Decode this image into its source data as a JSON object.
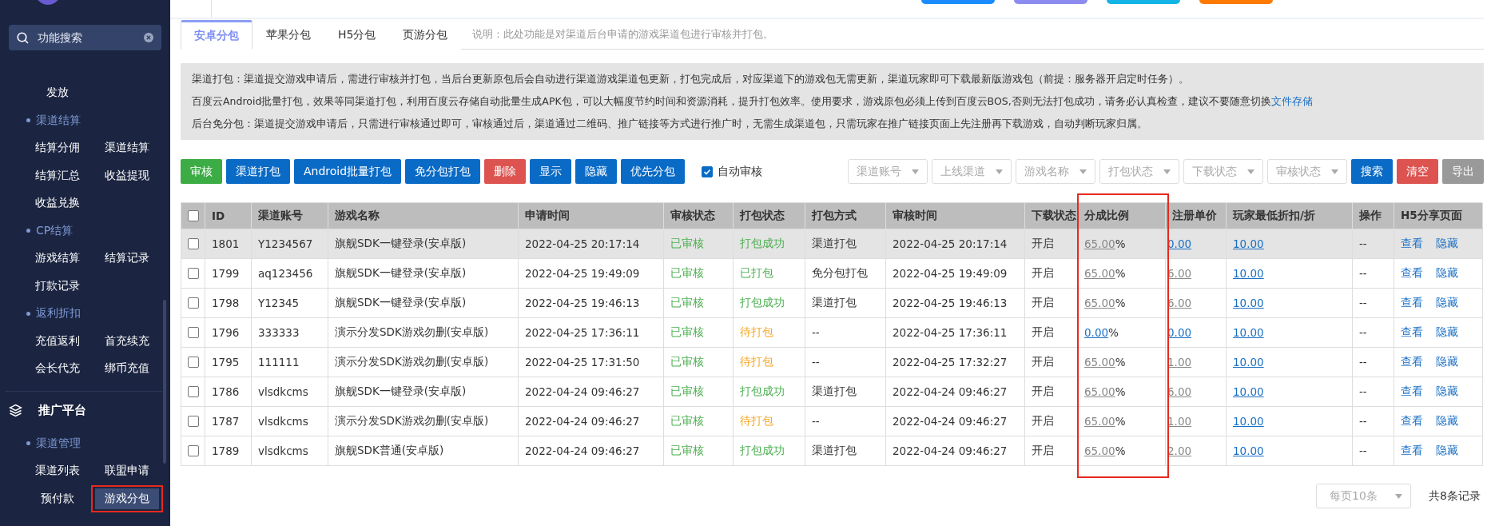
{
  "top_buttons": [
    {
      "color": "#1a8cff"
    },
    {
      "color": "#8c8cf0"
    },
    {
      "color": "#14b4e6"
    },
    {
      "color": "#ff7a00"
    }
  ],
  "sidebar": {
    "search": {
      "placeholder": "功能搜索"
    },
    "groups": [
      {
        "items": [
          {
            "label": "发放",
            "selected": false,
            "annotated": false
          }
        ]
      },
      {
        "title": "渠道结算",
        "items": [
          {
            "label": "结算分佣",
            "selected": false,
            "annotated": false
          },
          {
            "label": "渠道结算",
            "selected": false,
            "annotated": false
          },
          {
            "label": "结算汇总",
            "selected": false,
            "annotated": false
          },
          {
            "label": "收益提现",
            "selected": false,
            "annotated": false
          },
          {
            "label": "收益兑换",
            "selected": false,
            "annotated": false
          }
        ]
      },
      {
        "title": "CP结算",
        "items": [
          {
            "label": "游戏结算",
            "selected": false,
            "annotated": false
          },
          {
            "label": "结算记录",
            "selected": false,
            "annotated": false
          },
          {
            "label": "打款记录",
            "selected": false,
            "annotated": false
          }
        ]
      },
      {
        "title": "返利折扣",
        "items": [
          {
            "label": "充值返利",
            "selected": false,
            "annotated": false
          },
          {
            "label": "首充续充",
            "selected": false,
            "annotated": false
          },
          {
            "label": "会长代充",
            "selected": false,
            "annotated": false
          },
          {
            "label": "绑币充值",
            "selected": false,
            "annotated": false
          }
        ]
      }
    ],
    "menu": {
      "title": "推广平台",
      "groups": [
        {
          "title": "渠道管理",
          "items": [
            {
              "label": "渠道列表",
              "selected": false,
              "annotated": false
            },
            {
              "label": "联盟申请",
              "selected": false,
              "annotated": false
            },
            {
              "label": "预付款",
              "selected": false,
              "annotated": false
            },
            {
              "label": "游戏分包",
              "selected": true,
              "annotated": true
            }
          ]
        }
      ]
    }
  },
  "tabs": [
    {
      "label": "安卓分包",
      "selected": true
    },
    {
      "label": "苹果分包",
      "selected": false
    },
    {
      "label": "H5分包",
      "selected": false
    },
    {
      "label": "页游分包",
      "selected": false
    }
  ],
  "tab_note": "说明：此处功能是对渠道后台申请的游戏渠道包进行审核并打包。",
  "info": [
    {
      "text": "渠道打包：渠道提交游戏申请后，需进行审核并打包，当后台更新原包后会自动进行渠道游戏渠道包更新，打包完成后，对应渠道下的游戏包无需更新，渠道玩家即可下载最新版游戏包（前提：服务器开启定时任务）。"
    },
    {
      "text": "百度云Android批量打包，效果等同渠道打包，利用百度云存储自动批量生成APK包，可以大幅度节约时间和资源消耗，提升打包效率。使用要求，游戏原包必须上传到百度云BOS,否则无法打包成功，请务必认真检查，建议不要随意切换",
      "link": "文件存储"
    },
    {
      "text": "后台免分包：渠道提交游戏申请后，只需进行审核通过即可，审核通过后，渠道通过二维码、推广链接等方式进行推广时，无需生成渠道包，只需玩家在推广链接页面上先注册再下载游戏，自动判断玩家归属。"
    }
  ],
  "actions": [
    {
      "label": "审核",
      "kind": "success"
    },
    {
      "label": "渠道打包",
      "kind": "primary"
    },
    {
      "label": "Android批量打包",
      "kind": "primary"
    },
    {
      "label": "免分包打包",
      "kind": "primary"
    },
    {
      "label": "删除",
      "kind": "danger"
    },
    {
      "label": "显示",
      "kind": "primary"
    },
    {
      "label": "隐藏",
      "kind": "primary"
    },
    {
      "label": "优先分包",
      "kind": "primary"
    }
  ],
  "auto_review": {
    "label": "自动审核",
    "checked": true
  },
  "filters": [
    {
      "placeholder": "渠道账号"
    },
    {
      "placeholder": "上线渠道"
    },
    {
      "placeholder": "游戏名称"
    },
    {
      "placeholder": "打包状态"
    },
    {
      "placeholder": "下载状态"
    },
    {
      "placeholder": "审核状态"
    }
  ],
  "filter_buttons": [
    {
      "label": "搜索",
      "kind": "primary"
    },
    {
      "label": "清空",
      "kind": "danger"
    },
    {
      "label": "导出",
      "kind": "muted"
    }
  ],
  "table": {
    "all_checked": false,
    "columns": [
      {
        "label": "ID",
        "annotated": false
      },
      {
        "label": "渠道账号",
        "annotated": false
      },
      {
        "label": "游戏名称",
        "annotated": false
      },
      {
        "label": "申请时间",
        "annotated": false
      },
      {
        "label": "审核状态",
        "annotated": false
      },
      {
        "label": "打包状态",
        "annotated": false
      },
      {
        "label": "打包方式",
        "annotated": false
      },
      {
        "label": "审核时间",
        "annotated": false
      },
      {
        "label": "下载状态",
        "annotated": false
      },
      {
        "label": "分成比例",
        "annotated": true
      },
      {
        "label": "注册单价",
        "annotated": false
      },
      {
        "label": "玩家最低折扣/折",
        "annotated": false
      },
      {
        "label": "操作",
        "annotated": false
      },
      {
        "label": "H5分享页面",
        "annotated": false
      }
    ],
    "rows": [
      {
        "checked": false,
        "highlighted": true,
        "id": "1801",
        "account": "Y1234567",
        "game": "旗舰SDK一键登录(安卓版)",
        "apply_time": "2022-04-25 20:17:14",
        "review_status": "已审核",
        "pack_status": {
          "text": "打包成功",
          "color": "#4caf50"
        },
        "pack_method": "渠道打包",
        "review_time": "2022-04-25 20:17:14",
        "download_status": "开启",
        "share": {
          "value": "65.00",
          "suffix": "%",
          "color": "#888888"
        },
        "reg_price": {
          "value": "0.00",
          "color": "#1a6fc4"
        },
        "discount": "10.00",
        "operation": "--",
        "links": [
          "查看",
          "隐藏"
        ]
      },
      {
        "checked": false,
        "highlighted": false,
        "id": "1799",
        "account": "aq123456",
        "game": "旗舰SDK一键登录(安卓版)",
        "apply_time": "2022-04-25 19:49:09",
        "review_status": "已审核",
        "pack_status": {
          "text": "已打包",
          "color": "#4caf50"
        },
        "pack_method": "免分包打包",
        "review_time": "2022-04-25 19:49:09",
        "download_status": "开启",
        "share": {
          "value": "65.00",
          "suffix": "%",
          "color": "#888888"
        },
        "reg_price": {
          "value": "6.00",
          "color": "#888888"
        },
        "discount": "10.00",
        "operation": "--",
        "links": [
          "查看",
          "隐藏"
        ]
      },
      {
        "checked": false,
        "highlighted": false,
        "id": "1798",
        "account": "Y12345",
        "game": "旗舰SDK一键登录(安卓版)",
        "apply_time": "2022-04-25 19:46:13",
        "review_status": "已审核",
        "pack_status": {
          "text": "打包成功",
          "color": "#4caf50"
        },
        "pack_method": "渠道打包",
        "review_time": "2022-04-25 19:46:13",
        "download_status": "开启",
        "share": {
          "value": "65.00",
          "suffix": "%",
          "color": "#888888"
        },
        "reg_price": {
          "value": "6.00",
          "color": "#888888"
        },
        "discount": "10.00",
        "operation": "--",
        "links": [
          "查看",
          "隐藏"
        ]
      },
      {
        "checked": false,
        "highlighted": false,
        "id": "1796",
        "account": "333333",
        "game": "演示分发SDK游戏勿删(安卓版)",
        "apply_time": "2022-04-25 17:36:11",
        "review_status": "已审核",
        "pack_status": {
          "text": "待打包",
          "color": "#f5a623"
        },
        "pack_method": "--",
        "review_time": "2022-04-25 17:36:11",
        "download_status": "开启",
        "share": {
          "value": "0.00",
          "suffix": "%",
          "color": "#1a6fc4"
        },
        "reg_price": {
          "value": "0.00",
          "color": "#1a6fc4"
        },
        "discount": "10.00",
        "operation": "--",
        "links": [
          "查看",
          "隐藏"
        ]
      },
      {
        "checked": false,
        "highlighted": false,
        "id": "1795",
        "account": "111111",
        "game": "演示分发SDK游戏勿删(安卓版)",
        "apply_time": "2022-04-25 17:31:50",
        "review_status": "已审核",
        "pack_status": {
          "text": "待打包",
          "color": "#f5a623"
        },
        "pack_method": "--",
        "review_time": "2022-04-25 17:32:27",
        "download_status": "开启",
        "share": {
          "value": "65.00",
          "suffix": "%",
          "color": "#888888"
        },
        "reg_price": {
          "value": "1.00",
          "color": "#888888"
        },
        "discount": "10.00",
        "operation": "--",
        "links": [
          "查看",
          "隐藏"
        ]
      },
      {
        "checked": false,
        "highlighted": false,
        "id": "1786",
        "account": "vlsdkcms",
        "game": "旗舰SDK一键登录(安卓版)",
        "apply_time": "2022-04-24 09:46:27",
        "review_status": "已审核",
        "pack_status": {
          "text": "打包成功",
          "color": "#4caf50"
        },
        "pack_method": "渠道打包",
        "review_time": "2022-04-24 09:46:27",
        "download_status": "开启",
        "share": {
          "value": "65.00",
          "suffix": "%",
          "color": "#888888"
        },
        "reg_price": {
          "value": "6.00",
          "color": "#888888"
        },
        "discount": "10.00",
        "operation": "--",
        "links": [
          "查看",
          "隐藏"
        ]
      },
      {
        "checked": false,
        "highlighted": false,
        "id": "1787",
        "account": "vlsdkcms",
        "game": "演示分发SDK游戏勿删(安卓版)",
        "apply_time": "2022-04-24 09:46:27",
        "review_status": "已审核",
        "pack_status": {
          "text": "待打包",
          "color": "#f5a623"
        },
        "pack_method": "--",
        "review_time": "2022-04-24 09:46:27",
        "download_status": "开启",
        "share": {
          "value": "65.00",
          "suffix": "%",
          "color": "#888888"
        },
        "reg_price": {
          "value": "1.00",
          "color": "#888888"
        },
        "discount": "10.00",
        "operation": "--",
        "links": [
          "查看",
          "隐藏"
        ]
      },
      {
        "checked": false,
        "highlighted": false,
        "id": "1789",
        "account": "vlsdkcms",
        "game": "旗舰SDK普通(安卓版)",
        "apply_time": "2022-04-24 09:46:27",
        "review_status": "已审核",
        "pack_status": {
          "text": "打包成功",
          "color": "#4caf50"
        },
        "pack_method": "渠道打包",
        "review_time": "2022-04-24 09:46:27",
        "download_status": "开启",
        "share": {
          "value": "65.00",
          "suffix": "%",
          "color": "#888888"
        },
        "reg_price": {
          "value": "2.00",
          "color": "#888888"
        },
        "discount": "10.00",
        "operation": "--",
        "links": [
          "查看",
          "隐藏"
        ]
      }
    ]
  },
  "pagination": {
    "page_size": "每页10条",
    "total": "共8条记录"
  }
}
